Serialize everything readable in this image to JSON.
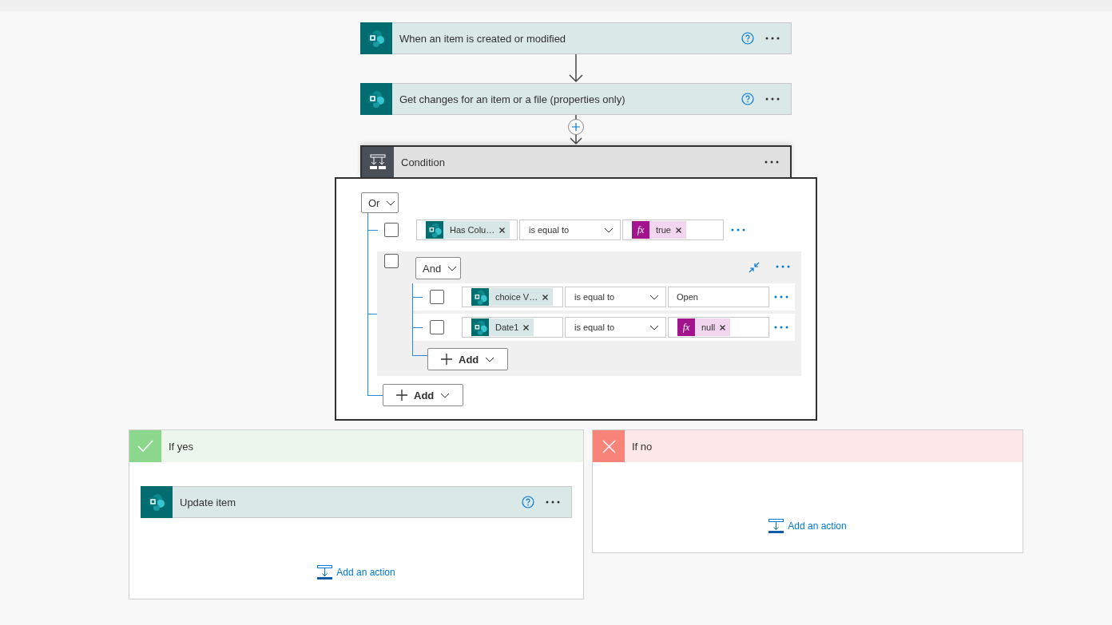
{
  "steps": [
    {
      "kind": "sharepoint",
      "title": "When an item is created or modified"
    },
    {
      "kind": "sharepoint",
      "title": "Get changes for an item or a file (properties only)"
    }
  ],
  "condition": {
    "title": "Condition",
    "operator": "Or",
    "add_label": "Add",
    "rows": [
      {
        "kind": "row",
        "checked": false,
        "left": {
          "kind": "sharepoint",
          "token": "Has Colu…"
        },
        "op": "is equal to",
        "right": {
          "kind": "expression",
          "badge": "fx",
          "token": "true"
        }
      },
      {
        "kind": "group",
        "checked": false,
        "operator": "And",
        "add_label": "Add",
        "rows": [
          {
            "checked": false,
            "left": {
              "kind": "sharepoint",
              "token": "choice V…"
            },
            "op": "is equal to",
            "right": {
              "kind": "text",
              "value": "Open"
            }
          },
          {
            "checked": false,
            "left": {
              "kind": "sharepoint",
              "token": "Date1"
            },
            "op": "is equal to",
            "right": {
              "kind": "expression",
              "badge": "fx",
              "token": "null"
            }
          }
        ]
      }
    ]
  },
  "branches": [
    {
      "kind": "yes",
      "title": "If yes",
      "actions": [
        {
          "kind": "sharepoint",
          "title": "Update item"
        }
      ],
      "add_action": "Add an action"
    },
    {
      "kind": "no",
      "title": "If no",
      "add_action": "Add an action"
    }
  ]
}
